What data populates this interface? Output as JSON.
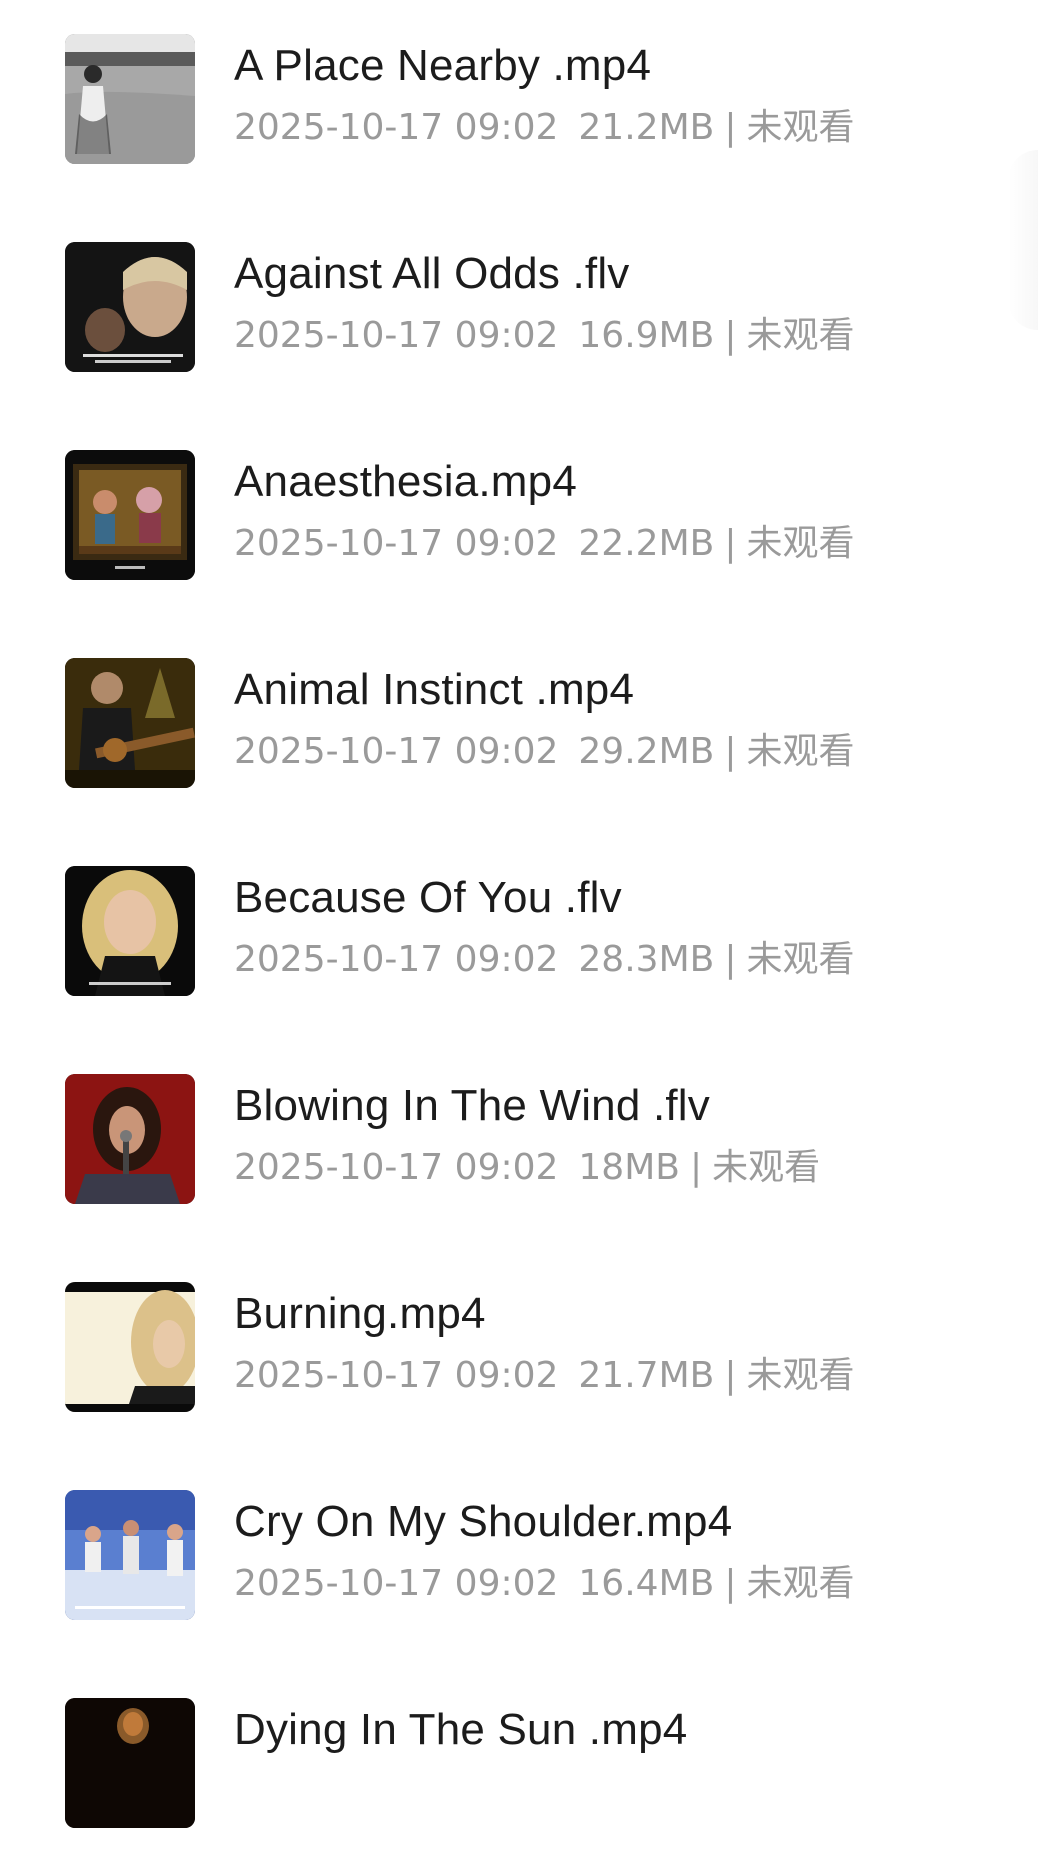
{
  "videos": [
    {
      "title": "A Place Nearby .mp4",
      "date": "2025-10-17 09:02",
      "size": "21.2MB",
      "status": "未观看",
      "thumbnail": "thumb-field"
    },
    {
      "title": "Against All Odds .flv",
      "date": "2025-10-17 09:02",
      "size": "16.9MB",
      "status": "未观看",
      "thumbnail": "thumb-closeup"
    },
    {
      "title": "Anaesthesia.mp4",
      "date": "2025-10-17 09:02",
      "size": "22.2MB",
      "status": "未观看",
      "thumbnail": "thumb-cartoon"
    },
    {
      "title": "Animal Instinct .mp4",
      "date": "2025-10-17 09:02",
      "size": "29.2MB",
      "status": "未观看",
      "thumbnail": "thumb-guitar"
    },
    {
      "title": "Because Of You .flv",
      "date": "2025-10-17 09:02",
      "size": "28.3MB",
      "status": "未观看",
      "thumbnail": "thumb-blonde"
    },
    {
      "title": "Blowing In The Wind .flv",
      "date": "2025-10-17 09:02",
      "size": "18MB",
      "status": "未观看",
      "thumbnail": "thumb-singer-red"
    },
    {
      "title": "Burning.mp4",
      "date": "2025-10-17 09:02",
      "size": "21.7MB",
      "status": "未观看",
      "thumbnail": "thumb-bright"
    },
    {
      "title": "Cry On My Shoulder.mp4",
      "date": "2025-10-17 09:02",
      "size": "16.4MB",
      "status": "未观看",
      "thumbnail": "thumb-stage"
    },
    {
      "title": "Dying In The Sun .mp4",
      "date": "",
      "size": "",
      "status": "",
      "thumbnail": "thumb-dark"
    }
  ],
  "colors": {
    "title": "#1c1c1c",
    "meta": "#9a9a9a",
    "background": "#ffffff"
  }
}
